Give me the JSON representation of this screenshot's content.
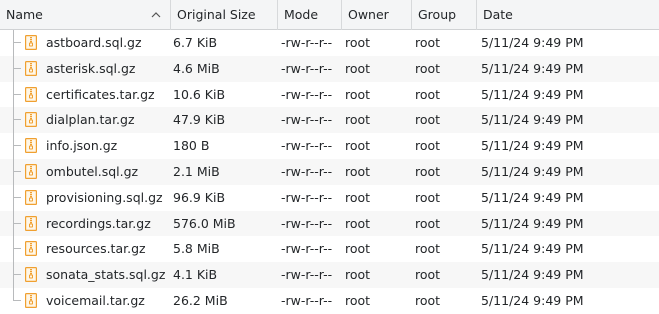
{
  "columns": [
    "Name",
    "Original Size",
    "Mode",
    "Owner",
    "Group",
    "Date"
  ],
  "sort": {
    "column": "Name",
    "direction": "ascending",
    "icon": "chevron-up-icon"
  },
  "file_icon": "archive-file-icon",
  "files": [
    {
      "name": "astboard.sql.gz",
      "size": "6.7 KiB",
      "mode": "-rw-r--r--",
      "owner": "root",
      "group": "root",
      "date": "5/11/24 9:49 PM"
    },
    {
      "name": "asterisk.sql.gz",
      "size": "4.6 MiB",
      "mode": "-rw-r--r--",
      "owner": "root",
      "group": "root",
      "date": "5/11/24 9:49 PM"
    },
    {
      "name": "certificates.tar.gz",
      "size": "10.6 KiB",
      "mode": "-rw-r--r--",
      "owner": "root",
      "group": "root",
      "date": "5/11/24 9:49 PM"
    },
    {
      "name": "dialplan.tar.gz",
      "size": "47.9 KiB",
      "mode": "-rw-r--r--",
      "owner": "root",
      "group": "root",
      "date": "5/11/24 9:49 PM"
    },
    {
      "name": "info.json.gz",
      "size": "180 B",
      "mode": "-rw-r--r--",
      "owner": "root",
      "group": "root",
      "date": "5/11/24 9:49 PM"
    },
    {
      "name": "ombutel.sql.gz",
      "size": "2.1 MiB",
      "mode": "-rw-r--r--",
      "owner": "root",
      "group": "root",
      "date": "5/11/24 9:49 PM"
    },
    {
      "name": "provisioning.sql.gz",
      "size": "96.9 KiB",
      "mode": "-rw-r--r--",
      "owner": "root",
      "group": "root",
      "date": "5/11/24 9:49 PM"
    },
    {
      "name": "recordings.tar.gz",
      "size": "576.0 MiB",
      "mode": "-rw-r--r--",
      "owner": "root",
      "group": "root",
      "date": "5/11/24 9:49 PM"
    },
    {
      "name": "resources.tar.gz",
      "size": "5.8 MiB",
      "mode": "-rw-r--r--",
      "owner": "root",
      "group": "root",
      "date": "5/11/24 9:49 PM"
    },
    {
      "name": "sonata_stats.sql.gz",
      "size": "4.1 KiB",
      "mode": "-rw-r--r--",
      "owner": "root",
      "group": "root",
      "date": "5/11/24 9:49 PM"
    },
    {
      "name": "voicemail.tar.gz",
      "size": "26.2 MiB",
      "mode": "-rw-r--r--",
      "owner": "root",
      "group": "root",
      "date": "5/11/24 9:49 PM"
    }
  ],
  "colors": {
    "header_bg": "#f4f5f6",
    "alt_row_bg": "#f7f7f7",
    "icon_orange": "#f0a030",
    "text": "#232629"
  }
}
